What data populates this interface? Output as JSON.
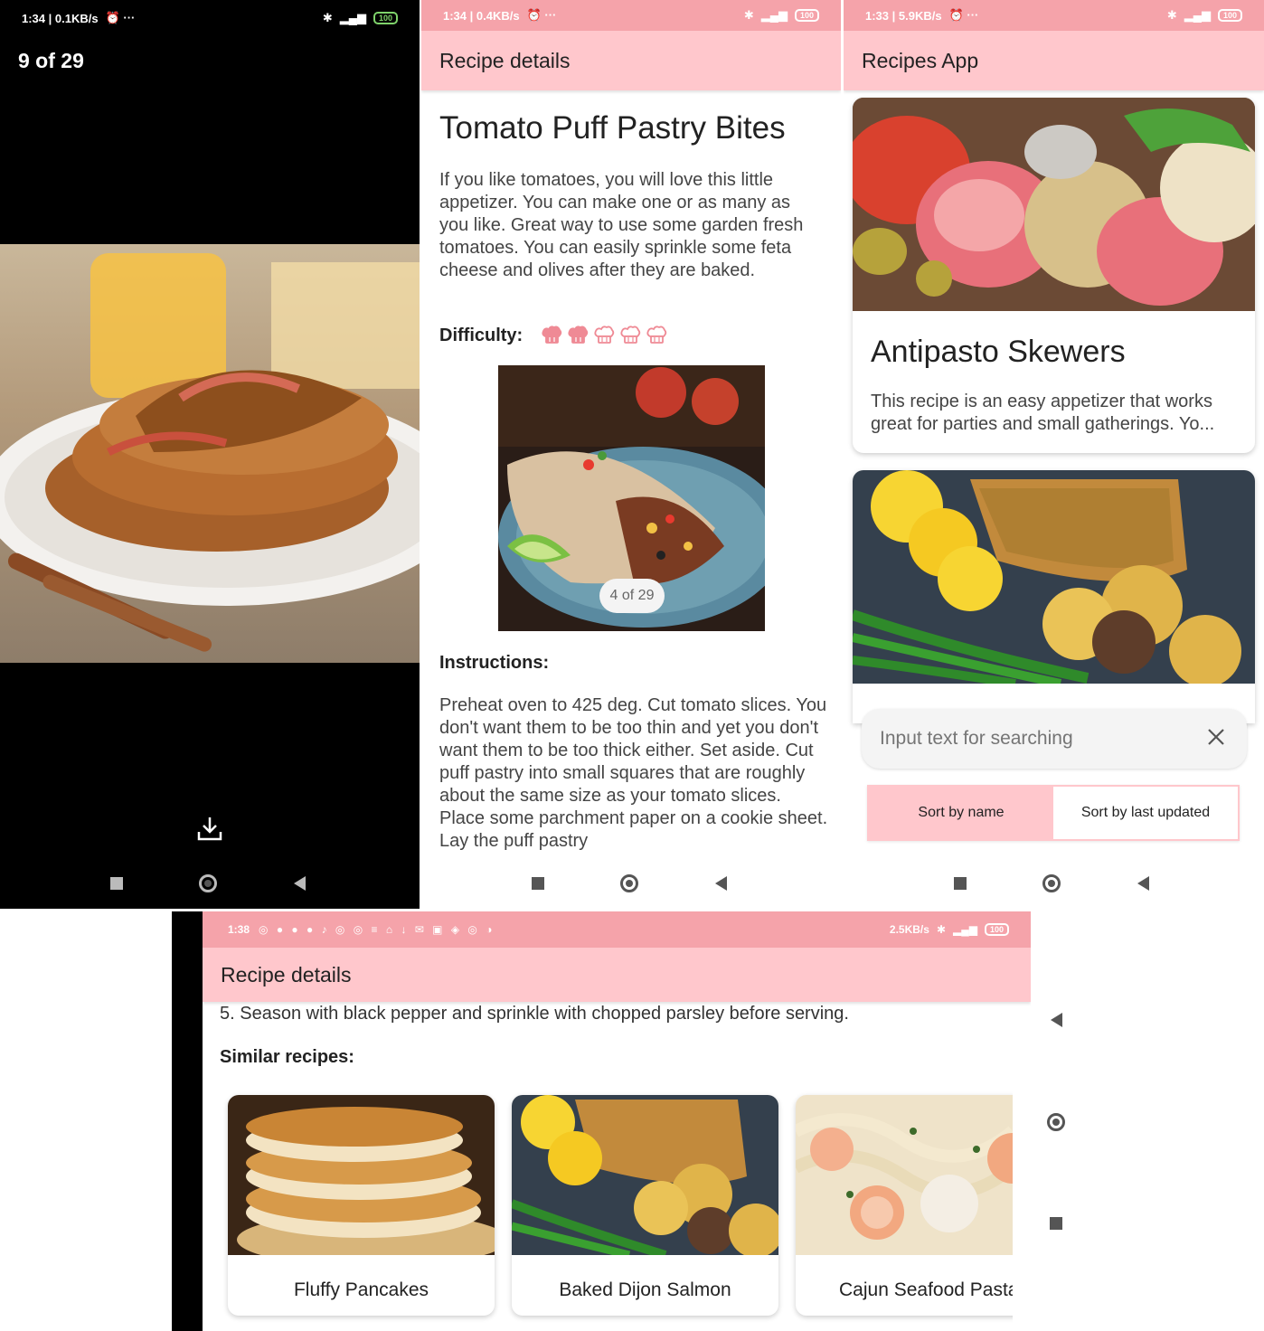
{
  "screen1": {
    "status_time": "1:34 | 0.1KB/s",
    "counter": "9 of 29",
    "battery": "100",
    "download_icon": "download-icon"
  },
  "screen2": {
    "status_time": "1:34 | 0.4KB/s",
    "battery": "100",
    "app_title": "Recipe details",
    "recipe_title": "Tomato Puff Pastry Bites",
    "description": "If you like tomatoes, you will love this little appetizer. You can make one or as many as you like. Great way to use some garden fresh tomatoes. You can easily sprinkle some feta cheese and olives after they are baked.",
    "difficulty_label": "Difficulty:",
    "difficulty_level": 2,
    "difficulty_max": 5,
    "image_counter": "4 of 29",
    "instructions_label": "Instructions:",
    "instructions": "Preheat oven to 425 deg. Cut tomato slices. You don't want them to be too thin and yet you don't want them to be too thick either. Set aside. Cut puff pastry into small squares that are roughly about the same size as your tomato slices. Place some parchment paper on a cookie sheet. Lay the puff pastry"
  },
  "screen3": {
    "status_time": "1:33 | 5.9KB/s",
    "battery": "100",
    "app_title": "Recipes App",
    "card_title": "Antipasto Skewers",
    "card_desc": "This recipe is an easy appetizer that works great for parties and small gatherings. Yo...",
    "search_placeholder": "Input text for searching",
    "sort_name": "Sort by name",
    "sort_updated": "Sort by last updated"
  },
  "screen4": {
    "status_time": "1:38",
    "status_speed": "2.5KB/s",
    "battery": "100",
    "app_title": "Recipe details",
    "step_text": "5. Season with black pepper and sprinkle with chopped parsley before serving.",
    "similar_label": "Similar recipes:",
    "similar": [
      {
        "name": "Fluffy Pancakes"
      },
      {
        "name": "Baked Dijon Salmon"
      },
      {
        "name": "Cajun Seafood Pasta"
      }
    ]
  },
  "colors": {
    "appbar": "#ffc7cc",
    "status_pink": "#f5a3aa",
    "chef_icon": "#ef8a95"
  }
}
